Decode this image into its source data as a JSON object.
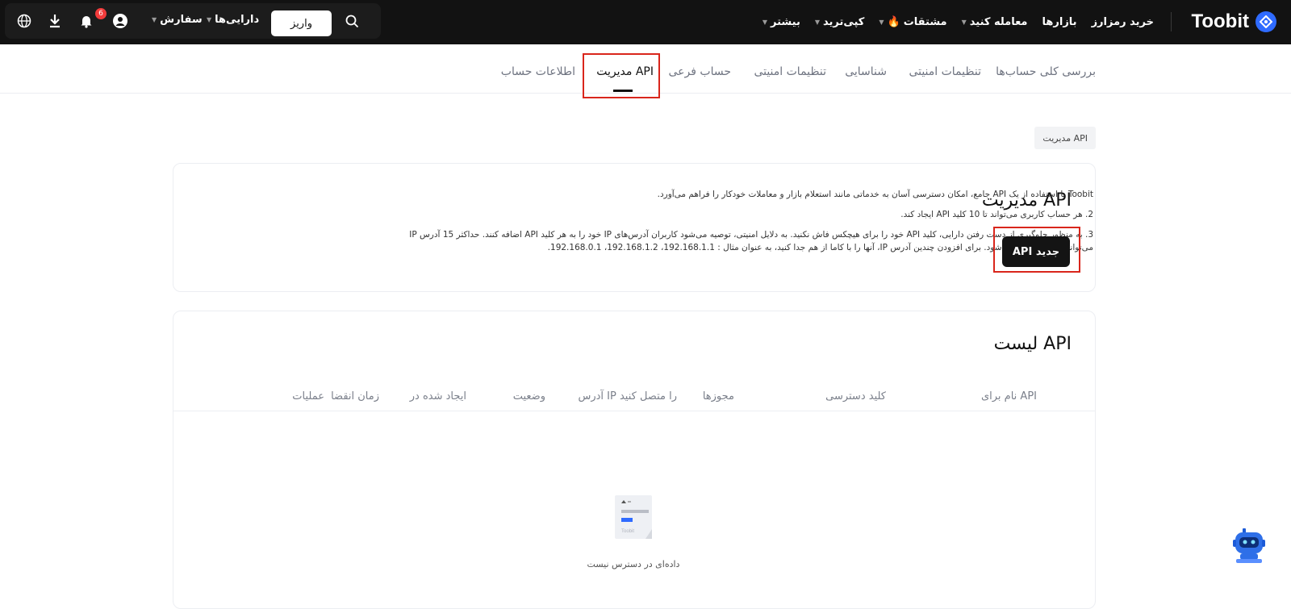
{
  "brand": {
    "name": "Toobit"
  },
  "nav": {
    "buy_crypto": "خرید رمزارز",
    "markets": "بازارها",
    "trade": "معامله کنید",
    "derivatives": "مشتقات",
    "copy_trade": "کپی‌ترید",
    "more": "بیشتر"
  },
  "toolbar": {
    "deposit": "واریز",
    "assets": "دارایی‌ها",
    "orders": "سفارش",
    "notification_count": "6"
  },
  "tabs": [
    {
      "label": "بررسی کلی حساب‌ها"
    },
    {
      "label": "تنظیمات امنیتی"
    },
    {
      "label": "شناسایی"
    },
    {
      "label": "تنظیمات امنیتی"
    },
    {
      "label": "حساب فرعی"
    },
    {
      "label": "مدیریت API",
      "active": true
    },
    {
      "label": "اطلاعات حساب"
    }
  ],
  "breadcrumb": "مدیریت API",
  "api_card": {
    "title": "مدیریت API",
    "new_button": "API جدید",
    "desc1": "Toobit با استفاده از یک API جامع، امکان دسترسی آسان به خدماتی مانند استعلام بازار و معاملات خودکار را فراهم می‌آورد.",
    "desc2": "2. هر حساب کاربری می‌تواند تا 10 کلید API ایجاد کند.",
    "desc3a": "3. به منظور جلوگیری از دست رفتن دارایی، کلید API خود را برای هیچکس فاش نکنید. به دلایل امنیتی، توصیه می‌شود کاربران آدرس‌های IP خود را به هر کلید API اضافه کنند. حداکثر 15 آدرس IP",
    "desc3b": "می‌تواند به هر کلید اضافه شود. برای افزودن چندین آدرس IP، آنها را با کاما از هم جدا کنید، به عنوان مثال : 192.168.1.1، 192.168.1.2، 192.168.0.1."
  },
  "api_list": {
    "title": "لیست API",
    "columns": {
      "name": "نام برای API",
      "access_key": "کلید دسترسی",
      "permissions": "مجوزها",
      "ip": "آدرس IP را متصل کنید",
      "status": "وضعیت",
      "created": "ایجاد شده در",
      "expiry": "زمان انقضا",
      "actions": "عملیات"
    },
    "empty_text": "داده‌ای در دسترس نیست",
    "empty_logo": "Toobit"
  },
  "colors": {
    "topbar": "#121212",
    "accent": "#2f6bff",
    "highlight": "#d9261c"
  }
}
